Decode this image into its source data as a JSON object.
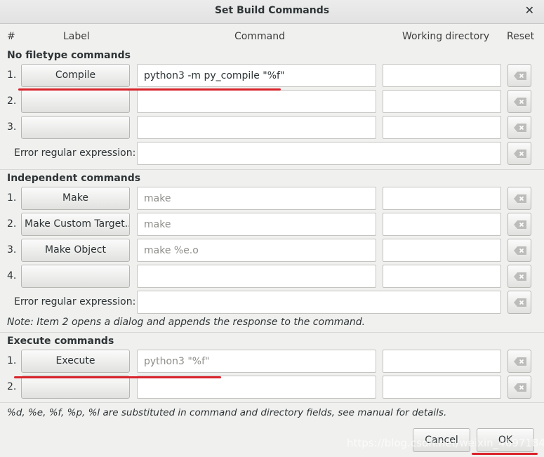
{
  "window": {
    "title": "Set Build Commands"
  },
  "columns": {
    "num": "#",
    "label": "Label",
    "command": "Command",
    "workdir": "Working directory",
    "reset": "Reset"
  },
  "filetype": {
    "heading": "No filetype commands",
    "rows": [
      {
        "num": "1.",
        "label": "Compile",
        "command": "python3 -m py_compile \"%f\"",
        "workdir": ""
      },
      {
        "num": "2.",
        "label": "",
        "command": "",
        "workdir": ""
      },
      {
        "num": "3.",
        "label": "",
        "command": "",
        "workdir": ""
      }
    ],
    "regex_label": "Error regular expression:"
  },
  "independent": {
    "heading": "Independent commands",
    "rows": [
      {
        "num": "1.",
        "label": "Make",
        "command_placeholder": "make",
        "workdir": ""
      },
      {
        "num": "2.",
        "label": "Make Custom Target...",
        "command_placeholder": "make",
        "workdir": ""
      },
      {
        "num": "3.",
        "label": "Make Object",
        "command_placeholder": "make %e.o",
        "workdir": ""
      },
      {
        "num": "4.",
        "label": "",
        "command_placeholder": "",
        "workdir": ""
      }
    ],
    "regex_label": "Error regular expression:",
    "note": "Note: Item 2 opens a dialog and appends the response to the command."
  },
  "execute": {
    "heading": "Execute commands",
    "rows": [
      {
        "num": "1.",
        "label": "Execute",
        "command_placeholder": "python3 \"%f\"",
        "workdir": ""
      },
      {
        "num": "2.",
        "label": "",
        "command_placeholder": "",
        "workdir": ""
      }
    ]
  },
  "footer_note": "%d, %e, %f, %p, %l are substituted in command and directory fields, see manual for details.",
  "buttons": {
    "cancel": "Cancel",
    "ok": "OK"
  },
  "watermark": "https://blog.csdn.net/weixin_46971845",
  "colors": {
    "annotation_red": "#d9232b"
  }
}
